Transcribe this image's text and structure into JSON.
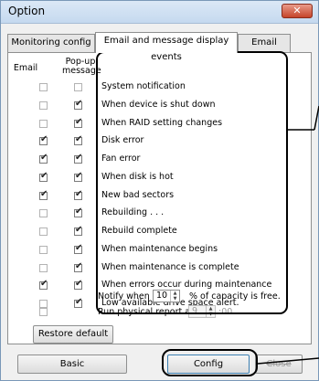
{
  "window": {
    "title": "Option",
    "close_glyph": "✕"
  },
  "tabs": [
    {
      "label": "Monitoring config"
    },
    {
      "label": "Email and message display events"
    },
    {
      "label": "Email config"
    }
  ],
  "columns": {
    "email": "Email",
    "popup": "Pop-up\nmessage"
  },
  "rows": [
    {
      "label": "System notification",
      "email": false,
      "popup": false
    },
    {
      "label": "When device is shut down",
      "email": false,
      "popup": true
    },
    {
      "label": "When RAID setting changes",
      "email": false,
      "popup": true
    },
    {
      "label": "Disk error",
      "email": true,
      "popup": true
    },
    {
      "label": "Fan error",
      "email": true,
      "popup": true
    },
    {
      "label": "When disk is hot",
      "email": true,
      "popup": true
    },
    {
      "label": "New bad sectors",
      "email": true,
      "popup": true
    },
    {
      "label": "Rebuilding . . .",
      "email": false,
      "popup": true
    },
    {
      "label": "Rebuild complete",
      "email": false,
      "popup": true
    },
    {
      "label": "When maintenance begins",
      "email": false,
      "popup": true
    },
    {
      "label": "When maintenance is complete",
      "email": false,
      "popup": true
    },
    {
      "label": "When errors occur during maintenance",
      "email": true,
      "popup": true
    },
    {
      "label": "Low available drive space alert.",
      "email": false,
      "popup": true
    }
  ],
  "notify": {
    "prefix": "Notify when",
    "value": "10",
    "suffix": "% of capacity is free."
  },
  "report": {
    "label": "Run physical report at",
    "hour": "9",
    "minutes": ":00",
    "checked": false
  },
  "buttons": {
    "restore_default": "Restore default",
    "basic": "Basic",
    "config": "Config",
    "close": "Close"
  },
  "colors": {
    "title_bar": "#c5d9ef",
    "close_button": "#c5442a",
    "panel": "#ffffff"
  }
}
